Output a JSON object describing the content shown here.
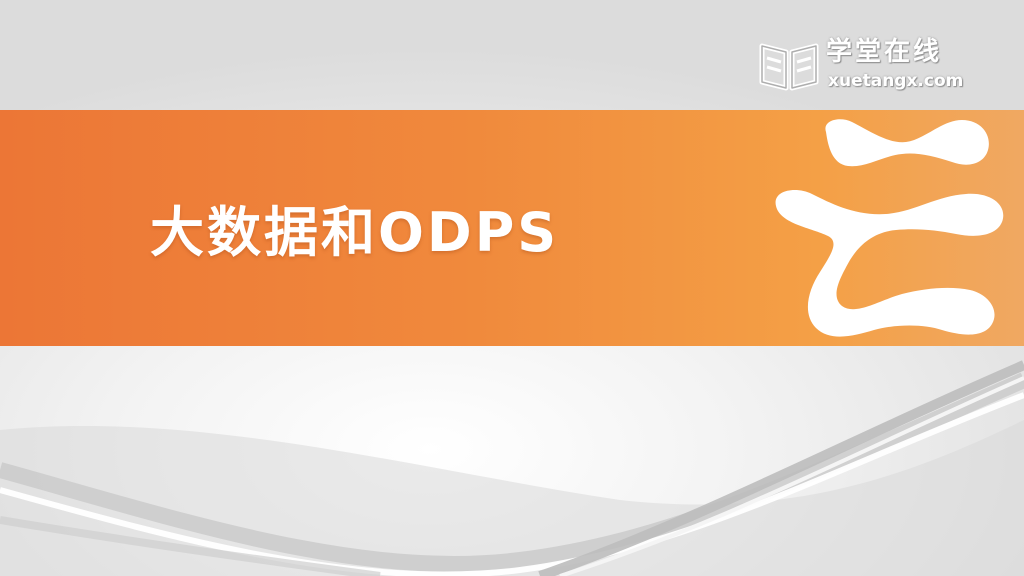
{
  "slide": {
    "title": "大数据和ODPS"
  },
  "brand": {
    "name": "学堂在线",
    "url": "xuetangx.com",
    "icon": "book-logo-icon"
  },
  "decoration": {
    "cloud_icon": "cloud-character-icon",
    "banner_color": "#f08a3c",
    "accent_white": "#ffffff"
  }
}
